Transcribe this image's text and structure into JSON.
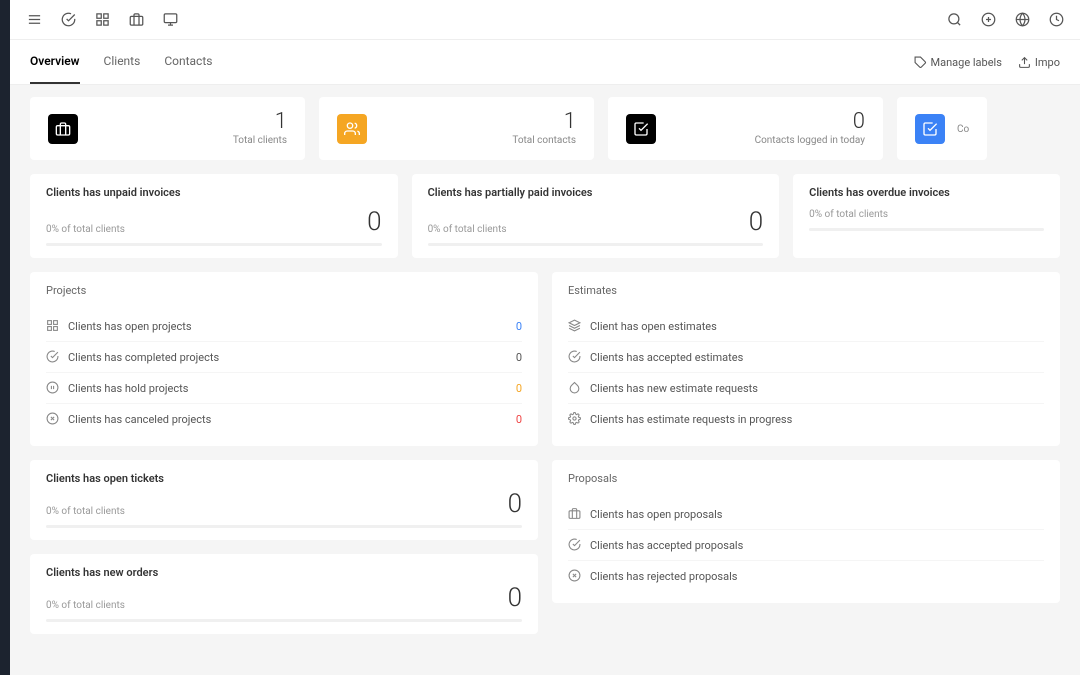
{
  "tabs": {
    "items": [
      {
        "label": "Overview",
        "active": true
      },
      {
        "label": "Clients",
        "active": false
      },
      {
        "label": "Contacts",
        "active": false
      }
    ],
    "manage_labels": "Manage labels",
    "import": "Impo"
  },
  "stats": [
    {
      "value": "1",
      "label": "Total clients",
      "icon": "briefcase",
      "color": "stat-dark"
    },
    {
      "value": "1",
      "label": "Total contacts",
      "icon": "users",
      "color": "stat-orange"
    },
    {
      "value": "0",
      "label": "Contacts logged in today",
      "icon": "check-square",
      "color": "stat-dark"
    },
    {
      "value": "",
      "label": "Co",
      "icon": "check-square",
      "color": "stat-blue"
    }
  ],
  "invoices": [
    {
      "title": "Clients has unpaid invoices",
      "sub": "0% of total clients",
      "value": "0"
    },
    {
      "title": "Clients has partially paid invoices",
      "sub": "0% of total clients",
      "value": "0"
    },
    {
      "title": "Clients has overdue invoices",
      "sub": "0% of total clients",
      "value": ""
    }
  ],
  "projects": {
    "title": "Projects",
    "items": [
      {
        "icon": "grid",
        "label": "Clients has open projects",
        "value": "0",
        "cls": "val-blue"
      },
      {
        "icon": "check-circle",
        "label": "Clients has completed projects",
        "value": "0",
        "cls": ""
      },
      {
        "icon": "pause-circle",
        "label": "Clients has hold projects",
        "value": "0",
        "cls": "val-orange"
      },
      {
        "icon": "x-circle",
        "label": "Clients has canceled projects",
        "value": "0",
        "cls": "val-red"
      }
    ]
  },
  "estimates": {
    "title": "Estimates",
    "items": [
      {
        "icon": "package",
        "label": "Client has open estimates"
      },
      {
        "icon": "check-circle",
        "label": "Clients has accepted estimates"
      },
      {
        "icon": "droplet",
        "label": "Clients has new estimate requests"
      },
      {
        "icon": "settings",
        "label": "Clients has estimate requests in progress"
      }
    ]
  },
  "tickets": {
    "title": "Clients has open tickets",
    "sub": "0% of total clients",
    "value": "0"
  },
  "orders": {
    "title": "Clients has new orders",
    "sub": "0% of total clients",
    "value": "0"
  },
  "proposals": {
    "title": "Proposals",
    "items": [
      {
        "icon": "briefcase",
        "label": "Clients has open proposals"
      },
      {
        "icon": "check-circle",
        "label": "Clients has accepted proposals"
      },
      {
        "icon": "x-circle",
        "label": "Clients has rejected proposals"
      }
    ]
  }
}
